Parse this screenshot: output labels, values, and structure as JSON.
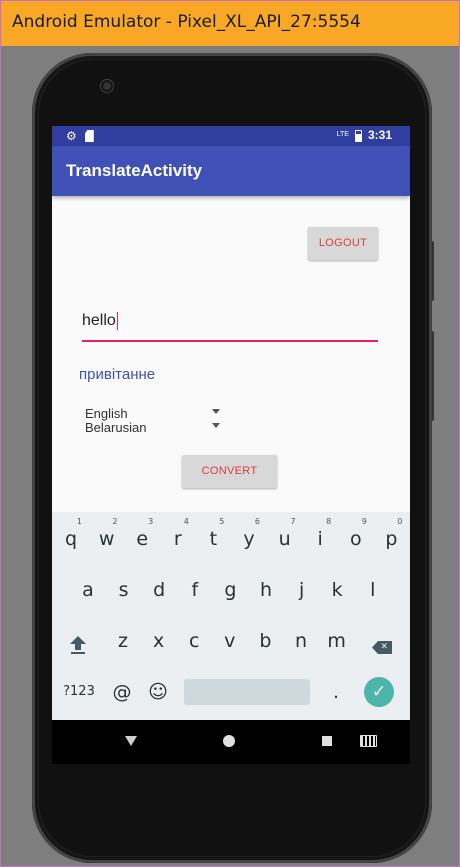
{
  "window": {
    "title": "Android Emulator - Pixel_XL_API_27:5554"
  },
  "statusbar": {
    "time": "3:31",
    "network_label": "LTE"
  },
  "appbar": {
    "title": "TranslateActivity"
  },
  "logout_button": {
    "label": "LOGOUT"
  },
  "input": {
    "value": "hello"
  },
  "result": {
    "text": "привітанне"
  },
  "spinners": {
    "source_language": "English",
    "target_language": "Belarusian"
  },
  "convert_button": {
    "label": "CONVERT"
  },
  "keyboard": {
    "row1": [
      {
        "k": "q",
        "h": "1"
      },
      {
        "k": "w",
        "h": "2"
      },
      {
        "k": "e",
        "h": "3"
      },
      {
        "k": "r",
        "h": "4"
      },
      {
        "k": "t",
        "h": "5"
      },
      {
        "k": "y",
        "h": "6"
      },
      {
        "k": "u",
        "h": "7"
      },
      {
        "k": "i",
        "h": "8"
      },
      {
        "k": "o",
        "h": "9"
      },
      {
        "k": "p",
        "h": "0"
      }
    ],
    "row2": [
      "a",
      "s",
      "d",
      "f",
      "g",
      "h",
      "j",
      "k",
      "l"
    ],
    "row3": [
      "z",
      "x",
      "c",
      "v",
      "b",
      "n",
      "m"
    ],
    "symbols_key": "?123",
    "at_key": "@",
    "emoji_key": "☺",
    "period_key": ".",
    "enter_icon": "check-icon"
  },
  "colors": {
    "accent": "#e91e63",
    "primary": "#3f51b5",
    "primary_dark": "#303f9f",
    "button_text": "#d3413f",
    "enter_key": "#4db6ac",
    "title_bar": "#f9a825"
  }
}
